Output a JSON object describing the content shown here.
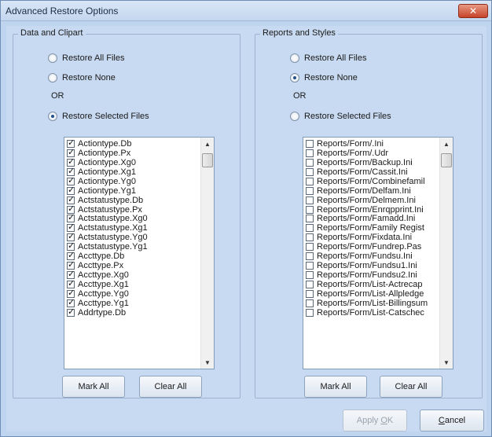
{
  "window": {
    "title": "Advanced Restore Options",
    "close_glyph": "✕"
  },
  "left_group": {
    "legend": "Data and Clipart",
    "radios": [
      {
        "label": "Restore All Files",
        "checked": false
      },
      {
        "label": "Restore None",
        "checked": false
      },
      {
        "label": "Restore Selected Files",
        "checked": true
      }
    ],
    "or_text": "OR",
    "items": [
      "Actiontype.Db",
      "Actiontype.Px",
      "Actiontype.Xg0",
      "Actiontype.Xg1",
      "Actiontype.Yg0",
      "Actiontype.Yg1",
      "Actstatustype.Db",
      "Actstatustype.Px",
      "Actstatustype.Xg0",
      "Actstatustype.Xg1",
      "Actstatustype.Yg0",
      "Actstatustype.Yg1",
      "Accttype.Db",
      "Accttype.Px",
      "Accttype.Xg0",
      "Accttype.Xg1",
      "Accttype.Yg0",
      "Accttype.Yg1",
      "Addrtype.Db"
    ],
    "items_checked": true,
    "mark_all": "Mark All",
    "clear_all": "Clear All"
  },
  "right_group": {
    "legend": "Reports and Styles",
    "radios": [
      {
        "label": "Restore All Files",
        "checked": false
      },
      {
        "label": "Restore None",
        "checked": true
      },
      {
        "label": "Restore Selected Files",
        "checked": false
      }
    ],
    "or_text": "OR",
    "items": [
      "Reports/Form/.Ini",
      "Reports/Form/.Udr",
      "Reports/Form/Backup.Ini",
      "Reports/Form/Cassit.Ini",
      "Reports/Form/Combinefamil",
      "Reports/Form/Delfam.Ini",
      "Reports/Form/Delmem.Ini",
      "Reports/Form/Enrqpprint.Ini",
      "Reports/Form/Famadd.Ini",
      "Reports/Form/Family Regist",
      "Reports/Form/Fixdata.Ini",
      "Reports/Form/Fundrep.Pas",
      "Reports/Form/Fundsu.Ini",
      "Reports/Form/Fundsu1.Ini",
      "Reports/Form/Fundsu2.Ini",
      "Reports/Form/List-Actrecap",
      "Reports/Form/List-Allpledge",
      "Reports/Form/List-Billingsum",
      "Reports/Form/List-Catschec"
    ],
    "items_checked": false,
    "mark_all": "Mark All",
    "clear_all": "Clear All"
  },
  "dialog_buttons": {
    "apply_ok_prefix": "Apply ",
    "apply_ok_underlined": "O",
    "apply_ok_suffix": "K",
    "cancel_underlined": "C",
    "cancel_suffix": "ancel"
  },
  "icons": {
    "scroll_up": "▲",
    "scroll_down": "▼"
  }
}
